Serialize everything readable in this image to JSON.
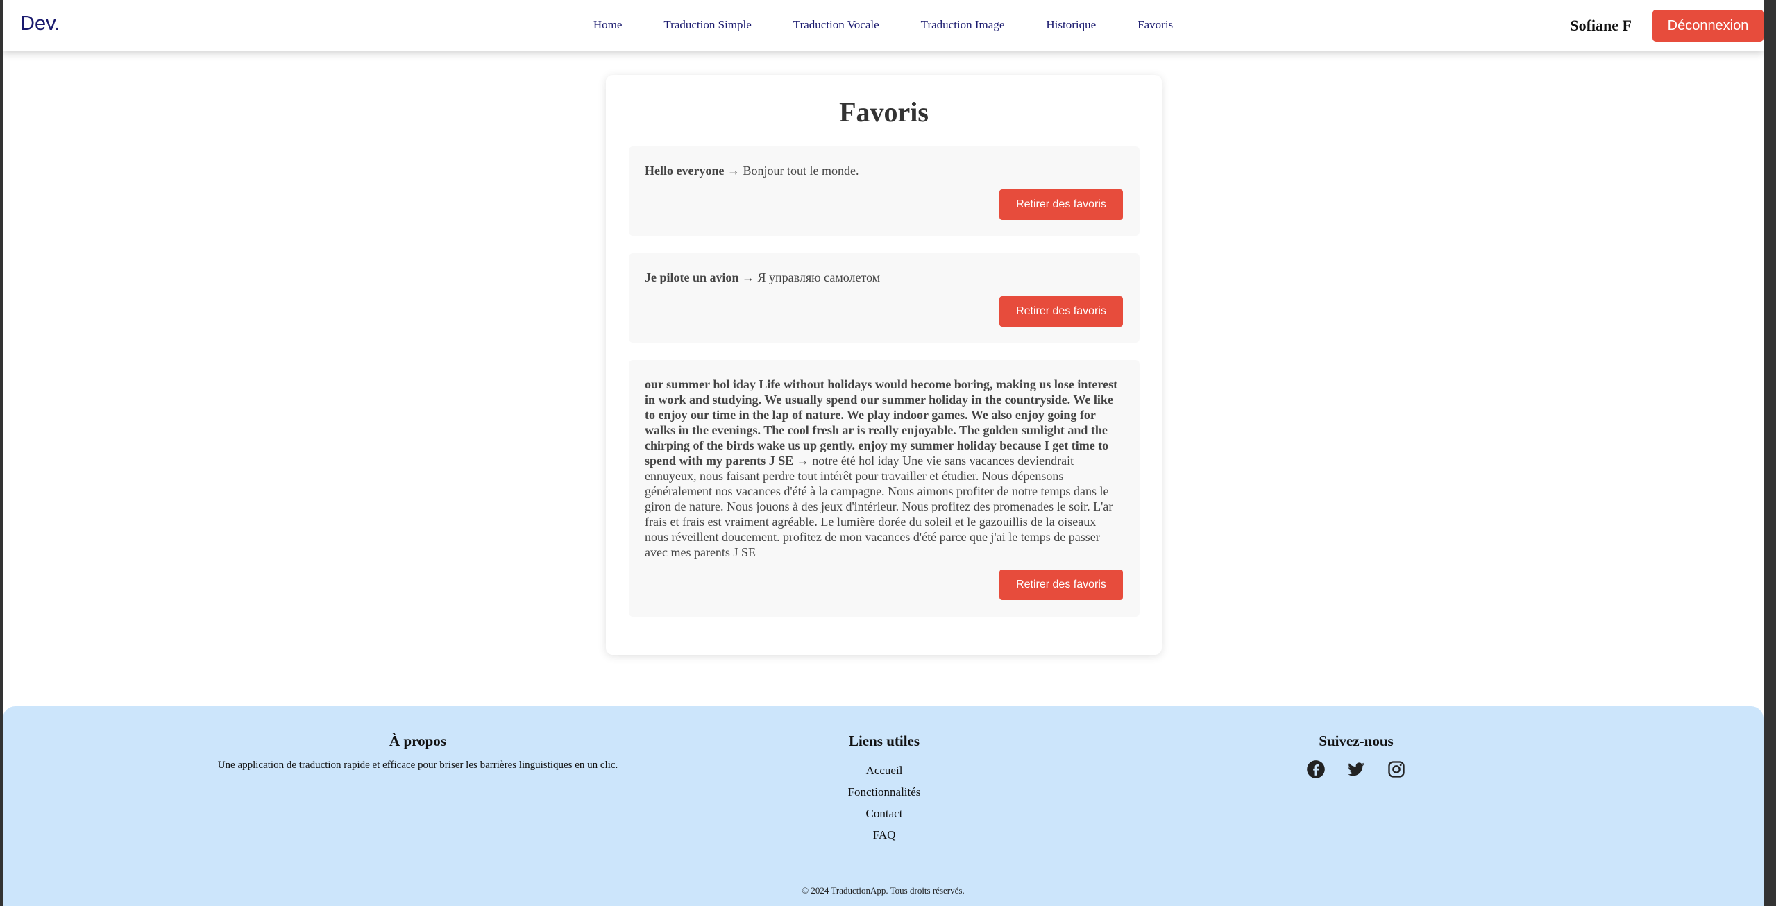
{
  "navbar": {
    "logo": "Dev.",
    "links": [
      "Home",
      "Traduction Simple",
      "Traduction Vocale",
      "Traduction Image",
      "Historique",
      "Favoris"
    ],
    "username": "Sofiane F",
    "logout_label": "Déconnexion",
    "logout_color": "#e74c3c",
    "link_color": "#1a1a6e"
  },
  "main": {
    "title": "Favoris",
    "favorites": [
      {
        "source": "Hello everyone",
        "arrow": "→",
        "translation": "Bonjour tout le monde.",
        "remove_label": "Retirer des favoris"
      },
      {
        "source": "Je pilote un avion",
        "arrow": "→",
        "translation": "Я управляю самолетом",
        "remove_label": "Retirer des favoris"
      },
      {
        "source": "our summer hol iday Life without holidays would become boring, making us lose interest in work and studying. We usually spend our summer holiday in the countryside. We like to enjoy our time in the lap of nature. We play indoor games. We also enjoy going for walks in the evenings. The cool fresh ar is really enjoyable. The golden sunlight and the chirping of the birds wake us up gently. enjoy my summer holiday because I get time to spend with my parents J SE",
        "arrow": "→",
        "translation": "notre été hol iday Une vie sans vacances deviendrait ennuyeux, nous faisant perdre tout intérêt pour travailler et étudier. Nous dépensons généralement nos vacances d'été à la campagne. Nous aimons profiter de notre temps dans le giron de nature. Nous jouons à des jeux d'intérieur. Nous profitez des promenades le soir. L'ar frais et frais est vraiment agréable. Le lumière dorée du soleil et le gazouillis de la oiseaux nous réveillent doucement. profitez de mon vacances d'été parce que j'ai le temps de passer avec mes parents J SE",
        "remove_label": "Retirer des favoris"
      }
    ]
  },
  "footer": {
    "about": {
      "title": "À propos",
      "text": "Une application de traduction rapide et efficace pour briser les barrières linguistiques en un clic."
    },
    "links": {
      "title": "Liens utiles",
      "items": [
        "Accueil",
        "Fonctionnalités",
        "Contact",
        "FAQ"
      ]
    },
    "social": {
      "title": "Suivez-nous",
      "icons": [
        "facebook-icon",
        "twitter-icon",
        "instagram-icon"
      ]
    },
    "copyright": "© 2024 TraductionApp. Tous droits réservés.",
    "background": "#cce5fb"
  }
}
